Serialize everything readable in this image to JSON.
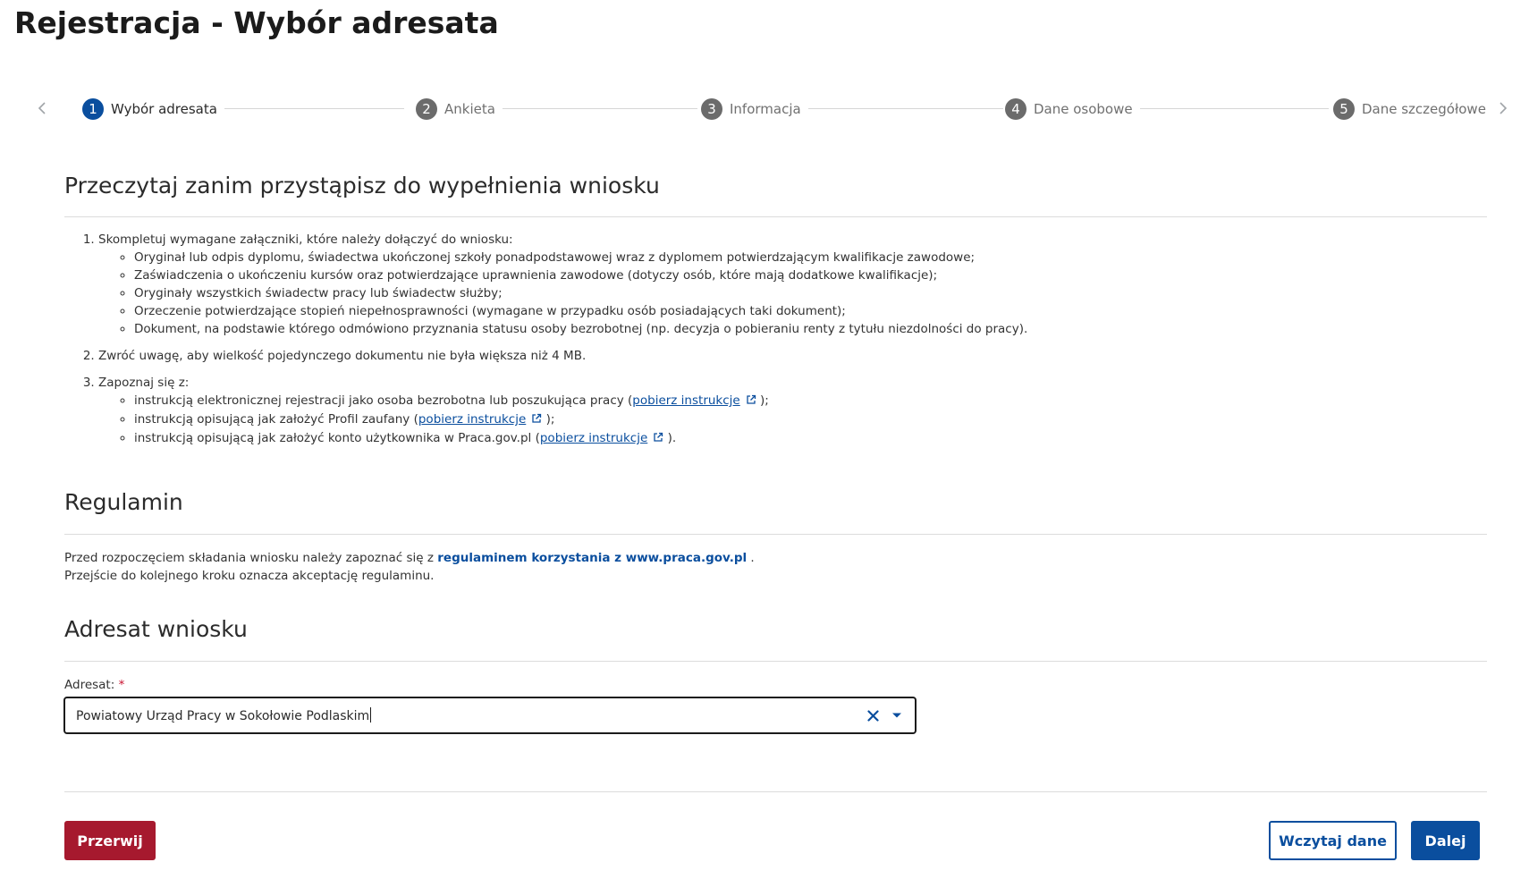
{
  "page": {
    "title": "Rejestracja - Wybór adresata"
  },
  "stepper": {
    "prev_icon": "chevron-left-icon",
    "next_icon": "chevron-right-icon",
    "steps": [
      {
        "number": "1",
        "label": "Wybór adresata",
        "state": "active"
      },
      {
        "number": "2",
        "label": "Ankieta",
        "state": "pending"
      },
      {
        "number": "3",
        "label": "Informacja",
        "state": "pending"
      },
      {
        "number": "4",
        "label": "Dane osobowe",
        "state": "pending"
      },
      {
        "number": "5",
        "label": "Dane szczegółowe",
        "state": "pending"
      }
    ]
  },
  "read_section": {
    "title": "Przeczytaj zanim przystąpisz do wypełnienia wniosku",
    "item1": {
      "text": "Skompletuj wymagane załączniki, które należy dołączyć do wniosku:",
      "bullets": [
        "Oryginał lub odpis dyplomu, świadectwa ukończonej szkoły ponadpodstawowej wraz z dyplomem potwierdzającym kwalifikacje zawodowe;",
        "Zaświadczenia o ukończeniu kursów oraz potwierdzające uprawnienia zawodowe (dotyczy osób, które mają dodatkowe kwalifikacje);",
        "Oryginały wszystkich świadectw pracy lub świadectw służby;",
        "Orzeczenie potwierdzające stopień niepełnosprawności (wymagane w przypadku osób posiadających taki dokument);",
        "Dokument, na podstawie którego odmówiono przyznania statusu osoby bezrobotnej (np. decyzja o pobieraniu renty z tytułu niezdolności do pracy)."
      ]
    },
    "item2": {
      "text": "Zwróć uwagę, aby wielkość pojedynczego dokumentu nie była większa niż 4 MB."
    },
    "item3": {
      "text": "Zapoznaj się z:",
      "links": [
        {
          "before": "instrukcją elektronicznej rejestracji jako osoba bezrobotna lub poszukująca pracy (",
          "link": "pobierz instrukcje",
          "after": " );"
        },
        {
          "before": "instrukcją opisującą jak założyć Profil zaufany (",
          "link": "pobierz instrukcje",
          "after": " );"
        },
        {
          "before": "instrukcją opisującą jak założyć konto użytkownika w Praca.gov.pl (",
          "link": "pobierz instrukcje",
          "after": " )."
        }
      ],
      "link_icon": "external-link-icon"
    }
  },
  "regulamin": {
    "title": "Regulamin",
    "line1_before": "Przed rozpoczęciem składania wniosku należy zapoznać się z ",
    "line1_link": "regulaminem korzystania z www.praca.gov.pl",
    "line1_after": " .",
    "line2": "Przejście do kolejnego kroku oznacza akceptację regulaminu."
  },
  "adresat": {
    "title": "Adresat wniosku",
    "label": "Adresat:",
    "required_mark": "*",
    "value": "Powiatowy Urząd Pracy w Sokołowie Podlaskim",
    "clear_icon": "close-icon",
    "dropdown_icon": "caret-down-icon"
  },
  "footer": {
    "cancel_label": "Przerwij",
    "load_label": "Wczytaj dane",
    "next_label": "Dalej"
  },
  "colors": {
    "primary": "#0a4e9e",
    "danger": "#a6192e",
    "step_inactive": "#6b6b6b",
    "divider": "#dcdcdc"
  }
}
